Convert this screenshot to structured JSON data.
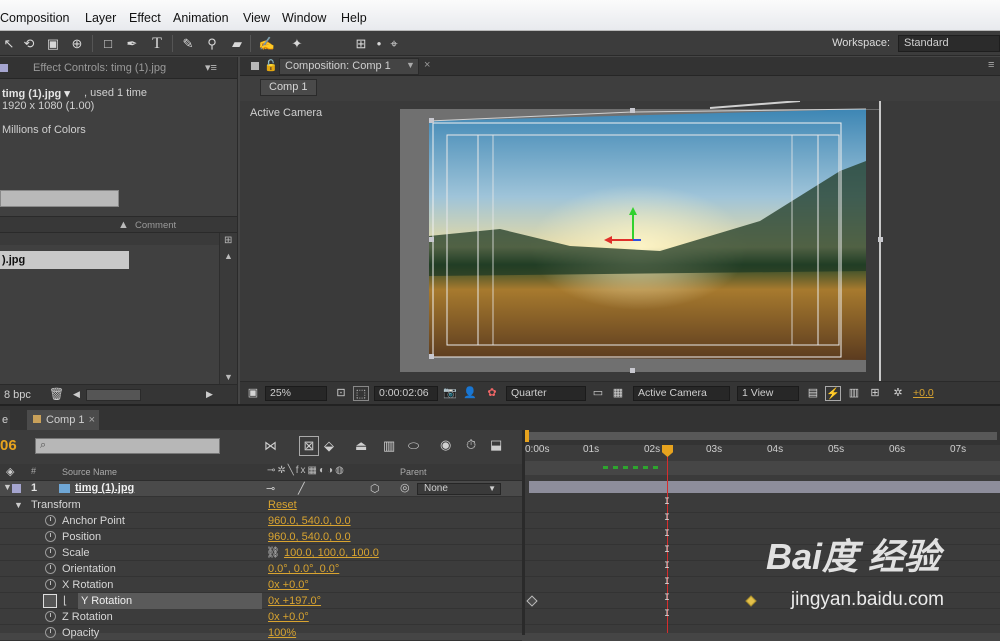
{
  "menu": {
    "items": [
      "Composition",
      "Layer",
      "Effect",
      "Animation",
      "View",
      "Window",
      "Help"
    ]
  },
  "toolbar": {
    "workspace_label": "Workspace:",
    "workspace_value": "Standard"
  },
  "effect_controls": {
    "panel_title": "Effect Controls: timg (1).jpg",
    "source_name": "timg (1).jpg ▾",
    "used": ", used 1 time",
    "dimensions": "1920 x 1080 (1.00)",
    "colors": "Millions of Colors",
    "comment_header": "Comment",
    "item_label": ").jpg",
    "bpc": "8 bpc"
  },
  "composition": {
    "tab_title": "Composition: Comp 1",
    "comp_button": "Comp 1",
    "camera_label": "Active Camera",
    "zoom": "25%",
    "timecode": "0:00:02:06",
    "resolution": "Quarter",
    "view_camera": "Active Camera",
    "views": "1 View",
    "exposure": "+0.0"
  },
  "timeline": {
    "left_tab": "e",
    "comp_tab": "Comp 1",
    "current_time": "06",
    "col_num": "#",
    "col_source": "Source Name",
    "col_parent": "Parent",
    "layer_index": "1",
    "layer_name": "timg (1).jpg",
    "parent_value": "None",
    "transform_label": "Transform",
    "reset_label": "Reset",
    "properties": [
      {
        "name": "Anchor Point",
        "value": "960.0, 540.0, 0.0"
      },
      {
        "name": "Position",
        "value": "960.0, 540.0, 0.0"
      },
      {
        "name": "Scale",
        "value": "100.0, 100.0, 100.0"
      },
      {
        "name": "Orientation",
        "value": "0.0°, 0.0°, 0.0°"
      },
      {
        "name": "X Rotation",
        "value": "0x +0.0°"
      },
      {
        "name": "Y Rotation",
        "value": "0x +197.0°"
      },
      {
        "name": "Z Rotation",
        "value": "0x +0.0°"
      },
      {
        "name": "Opacity",
        "value": "100%"
      }
    ],
    "ruler": [
      "0:00s",
      "01s",
      "02s",
      "03s",
      "04s",
      "05s",
      "06s",
      "07s"
    ]
  },
  "watermark": {
    "brand": "Bai度 经验",
    "url": "jingyan.baidu.com"
  },
  "colors": {
    "accent": "#d9a430",
    "playhead": "#d62d2d",
    "keyframe_active": "#e3c04b"
  }
}
